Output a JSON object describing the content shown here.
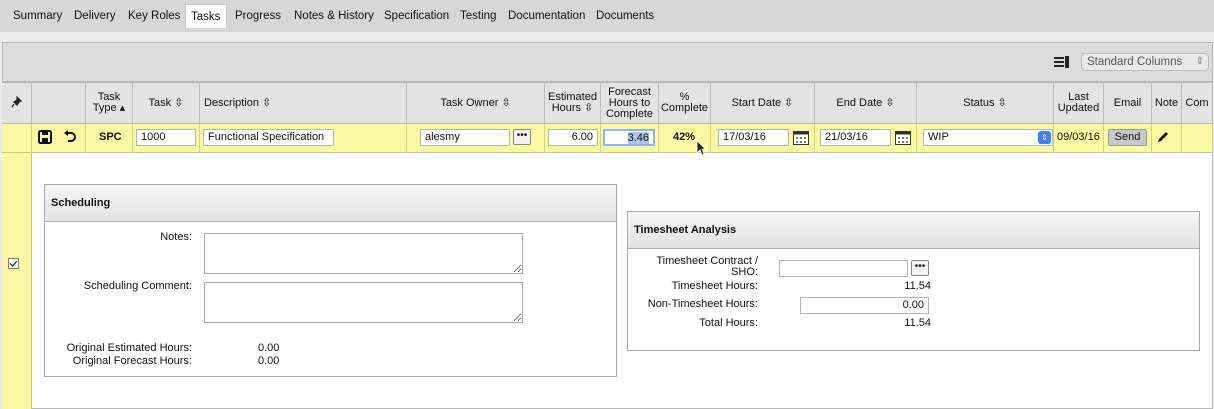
{
  "tabs": [
    {
      "label": "Summary"
    },
    {
      "label": "Delivery"
    },
    {
      "label": "Key Roles"
    },
    {
      "label": "Tasks",
      "active": true
    },
    {
      "label": "Progress"
    },
    {
      "label": "Notes & History"
    },
    {
      "label": "Specification"
    },
    {
      "label": "Testing"
    },
    {
      "label": "Documentation"
    },
    {
      "label": "Documents"
    }
  ],
  "toolbar": {
    "column_set": "Standard Columns"
  },
  "columns": {
    "task_type": "Task Type ▴",
    "task": "Task ⇳",
    "description": "Description ⇳",
    "task_owner": "Task Owner ⇳",
    "estimated_hours": "Estimated Hours ⇳",
    "forecast_hours": "Forecast Hours to Complete",
    "pct_complete": "% Complete",
    "start_date": "Start Date ⇳",
    "end_date": "End Date ⇳",
    "status": "Status ⇳",
    "last_updated": "Last Updated",
    "email": "Email",
    "note": "Note",
    "com": "Com"
  },
  "task_row": {
    "task_type": "SPC",
    "task": "1000",
    "description": "Functional Specification",
    "task_owner": "alesmy",
    "estimated_hours": "6.00",
    "forecast_hours": "3.46",
    "pct_complete": "42%",
    "start_date": "17/03/16",
    "end_date": "21/03/16",
    "status": "WIP",
    "last_updated": "09/03/16",
    "email_button": "Send",
    "dots": "•••"
  },
  "scheduling": {
    "title": "Scheduling",
    "notes_label": "Notes:",
    "comment_label": "Scheduling Comment:",
    "orig_est_label": "Original Estimated Hours:",
    "orig_est_value": "0.00",
    "orig_fc_label": "Original Forecast Hours:",
    "orig_fc_value": "0.00"
  },
  "timesheet": {
    "title": "Timesheet Analysis",
    "contract_label": "Timesheet Contract / SHO:",
    "hours_label": "Timesheet Hours:",
    "hours_value": "11.54",
    "non_label": "Non-Timesheet Hours:",
    "non_value": "0.00",
    "total_label": "Total Hours:",
    "total_value": "11.54"
  },
  "colors": {
    "row_highlight": "#fbf8a3",
    "status_stepper": "#3b82f6"
  }
}
